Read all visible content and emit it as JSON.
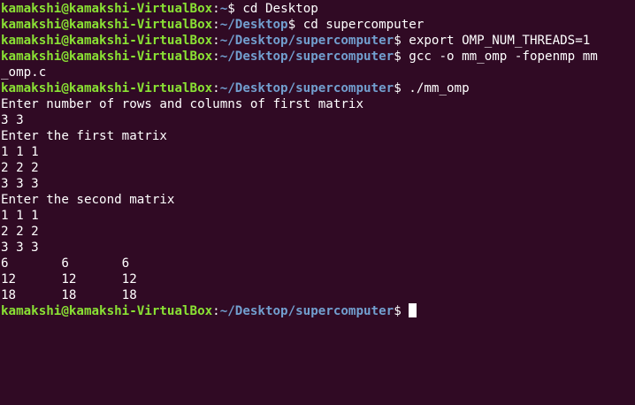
{
  "terminal": {
    "prompt_user": "kamakshi@kamakshi-VirtualBox",
    "prompt_colon": ":",
    "prompt_dollar": "$ ",
    "paths": {
      "home": "~",
      "desktop": "~/Desktop",
      "supercomputer": "~/Desktop/supercomputer"
    },
    "commands": [
      "cd Desktop",
      "cd supercomputer",
      "export OMP_NUM_THREADS=1",
      "gcc -o mm_omp -fopenmp mm",
      "./mm_omp"
    ],
    "wrapped_continuation": "_omp.c",
    "output": [
      "Enter number of rows and columns of first matrix",
      "3 3",
      "Enter the first matrix",
      "1 1 1",
      "2 2 2",
      "3 3 3",
      "Enter the second matrix",
      "1 1 1",
      "2 2 2",
      "3 3 3",
      "6       6       6",
      "12      12      12",
      "18      18      18"
    ]
  },
  "colors": {
    "background": "#300a24",
    "prompt_user": "#8ae234",
    "prompt_path": "#729fcf",
    "text": "#ffffff"
  }
}
